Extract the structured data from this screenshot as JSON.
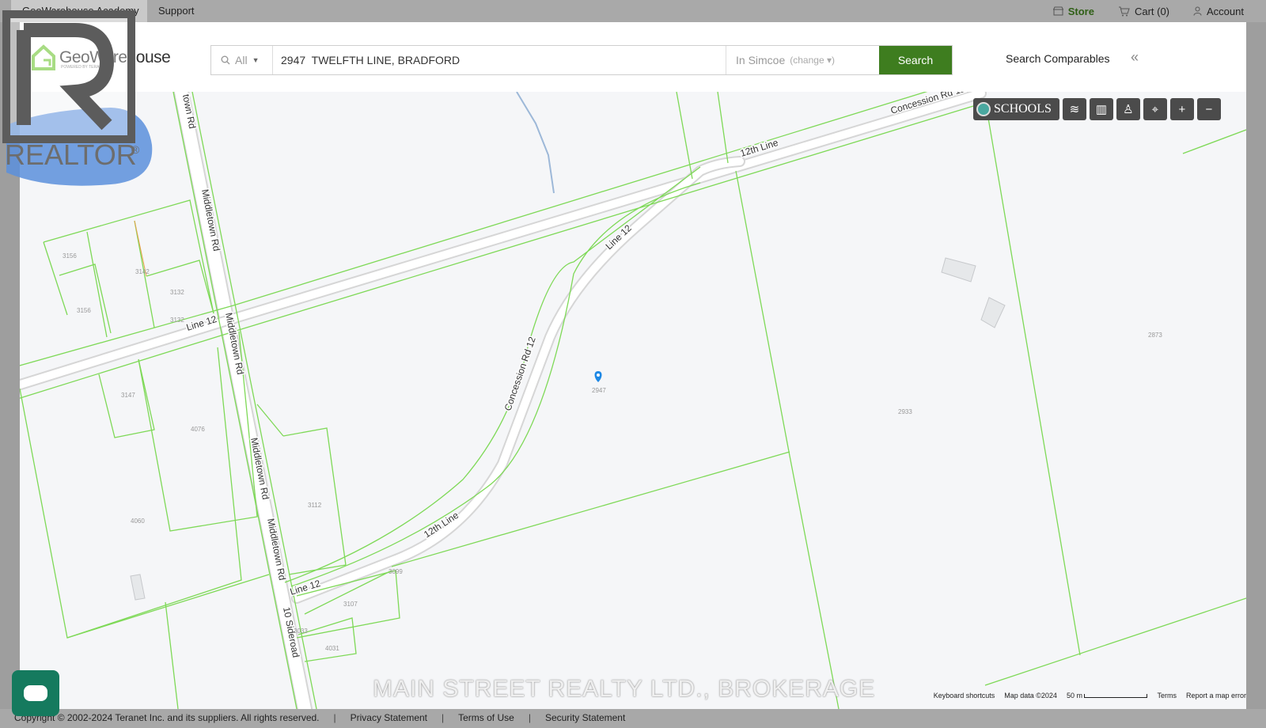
{
  "topbar": {
    "academy": "GeoWarehouse Academy",
    "support": "Support",
    "store": "Store",
    "cart": "Cart (0)",
    "account": "Account"
  },
  "header": {
    "logo_text": "GeoWarehouse",
    "logo_sub": "POWERED BY TERANET",
    "filter": "All",
    "search_value": "2947  TWELFTH LINE, BRADFORD",
    "region": "In Simcoe",
    "region_change": "(change ▾)",
    "search_button": "Search",
    "comparables": "Search Comparables"
  },
  "map": {
    "schools_label": "SCHOOLS",
    "roads": {
      "middletown_1": "Middletown Rd",
      "middletown_2": "Middletown Rd",
      "middletown_3": "Middletown Rd",
      "middletown_4": "Middletown Rd",
      "middletown_top": "town Rd",
      "line12_a": "Line 12",
      "line12_b": "Line 12",
      "line12_c": "Line 12",
      "twelfth_a": "12th Line",
      "twelfth_b": "12th Line",
      "concession_a": "Concession Rd 12",
      "concession_b": "Concession Rd 12",
      "sideroad": "10 Sideroad"
    },
    "parcels": {
      "p3156a": "3156",
      "p3142": "3142",
      "p3132a": "3132",
      "p3156b": "3156",
      "p3132b": "3132",
      "p3147": "3147",
      "p4076": "4076",
      "p4060": "4060",
      "p3112": "3112",
      "p3099": "3099",
      "p3107": "3107",
      "p3033": "3033",
      "p4031": "4031",
      "p2947": "2947",
      "p2933": "2933",
      "p2873": "2873"
    },
    "attribution": {
      "shortcuts": "Keyboard shortcuts",
      "data": "Map data ©2024",
      "scale": "50 m",
      "terms": "Terms",
      "report": "Report a map error"
    },
    "watermark": "MAIN STREET REALTY LTD., BROKERAGE"
  },
  "footer": {
    "copyright": "Copyright © 2002-2024 Teranet Inc. and its suppliers. All rights reserved.",
    "privacy": "Privacy Statement",
    "terms": "Terms of Use",
    "security": "Security Statement",
    "sep": "|"
  },
  "realtor": {
    "label": "REALTOR",
    "mark": "®"
  },
  "colors": {
    "accent": "#3e7d1f",
    "parcel_line": "#7ed957",
    "road_fill": "#ffffff",
    "marker": "#1e88e5"
  }
}
